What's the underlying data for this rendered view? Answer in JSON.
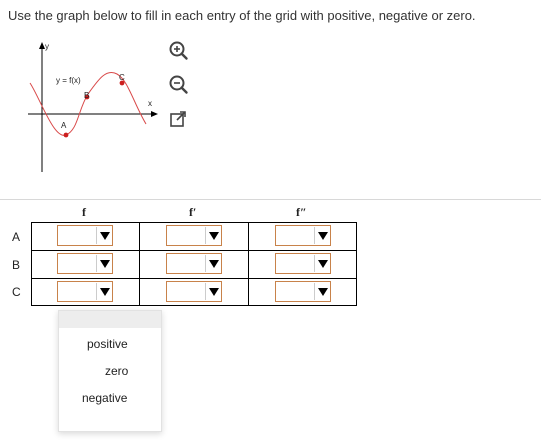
{
  "instruction": "Use the graph below to fill in each entry of the grid with positive, negative or zero.",
  "graph": {
    "y_axis_label": "y",
    "x_axis_label": "x",
    "function_label": "y = f(x)",
    "points": [
      "A",
      "B",
      "C"
    ]
  },
  "zoom_controls": [
    "zoom-in-icon",
    "zoom-out-icon",
    "open-new-window-icon"
  ],
  "grid": {
    "columns": [
      "f",
      "f′",
      "f″"
    ],
    "rows": [
      "A",
      "B",
      "C"
    ],
    "selected_values": [
      [
        "",
        "",
        ""
      ],
      [
        "",
        "",
        ""
      ],
      [
        "",
        "",
        ""
      ]
    ]
  },
  "dropdown": {
    "options": [
      "positive",
      "zero",
      "negative"
    ]
  },
  "colors": {
    "curve": "#d94a4a",
    "point": "#cc1f1f",
    "select_border": "#c8824a"
  }
}
